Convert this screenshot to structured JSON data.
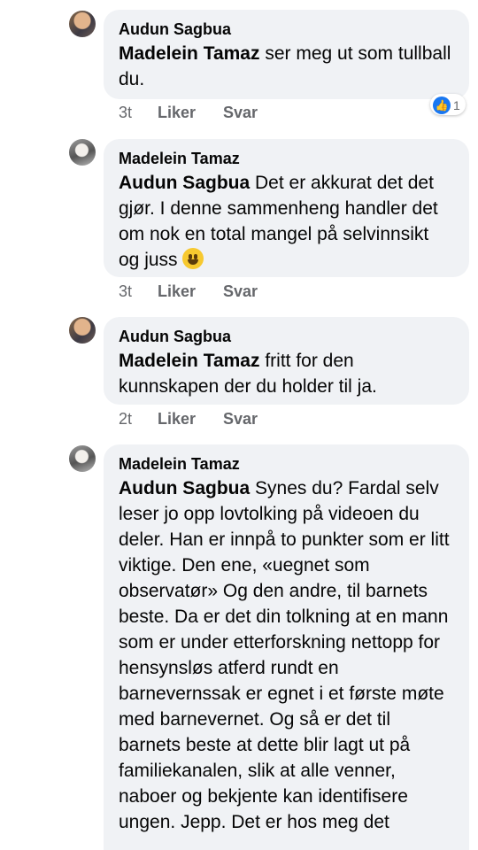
{
  "comments": [
    {
      "author": "Audun Sagbua",
      "mention": "Madelein Tamaz",
      "text": " ser meg ut som tullball du.",
      "time": "3t",
      "like": "Liker",
      "reply": "Svar",
      "reaction_count": "1",
      "reaction_icon": "thumbs-up-icon"
    },
    {
      "author": "Madelein Tamaz",
      "mention": "Audun Sagbua",
      "text": " Det er akkurat det det gjør. I denne sammenheng handler det om nok en total mangel på selvinnsikt og juss ",
      "emoji": "grinning-emoji-icon",
      "time": "3t",
      "like": "Liker",
      "reply": "Svar"
    },
    {
      "author": "Audun Sagbua",
      "mention": "Madelein Tamaz",
      "text": " fritt for den kunnskapen der du holder til ja.",
      "time": "2t",
      "like": "Liker",
      "reply": "Svar"
    },
    {
      "author": "Madelein Tamaz",
      "mention": "Audun Sagbua",
      "text": " Synes du? Fardal selv leser jo opp lovtolking på videoen du deler. Han er innpå to punkter som er litt viktige. Den ene, «uegnet som observatør» Og den andre, til barnets beste. Da er det din tolkning at en mann som er under etterforskning nettopp for hensynsløs atferd rundt en barnevernssak er egnet i et første møte med barnevernet. Og så er det til barnets beste at dette blir lagt ut på familiekanalen, slik at alle venner, naboer og bekjente kan identifisere ungen. Jepp. Det er hos meg det"
    }
  ]
}
